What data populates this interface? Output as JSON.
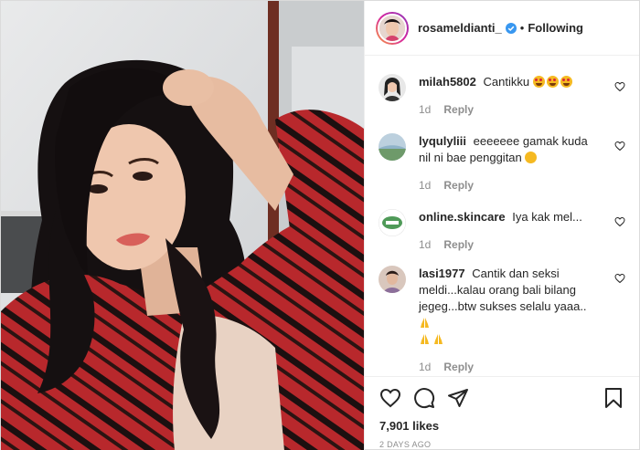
{
  "header": {
    "username": "rosameldianti_",
    "verified": true,
    "separator": "•",
    "follow_status": "Following"
  },
  "comments": [
    {
      "username": "milah5802",
      "text": "Cantikku",
      "emoji": "star-struck-x3",
      "time": "1d",
      "reply": "Reply",
      "avatar_color": "#3a3a3a"
    },
    {
      "username": "lyqulyliii",
      "text": "eeeeeee gamak kuda nil ni bae penggitan",
      "emoji": "crying-face",
      "time": "1d",
      "reply": "Reply",
      "avatar_color": "#7a9ab5"
    },
    {
      "username": "online.skincare",
      "text": "Iya kak mel...",
      "time": "1d",
      "reply": "Reply",
      "avatar_color": "#4f9a58"
    },
    {
      "username": "lasi1977",
      "text": "Cantik dan seksi meldi...kalau orang bali bilang jegeg...btw sukses selalu yaaa..",
      "emoji": "folded-hands-x3",
      "time": "1d",
      "reply": "Reply",
      "avatar_color": "#b58f7b"
    }
  ],
  "actions": {
    "icons": [
      "heart-icon",
      "comment-icon",
      "share-icon",
      "bookmark-icon"
    ]
  },
  "likes": "7,901 likes",
  "posted": "2 DAYS AGO",
  "colors": {
    "accent_verified": "#3897f0",
    "shirt_red": "#b3262a",
    "muted": "#8e8e8e"
  }
}
